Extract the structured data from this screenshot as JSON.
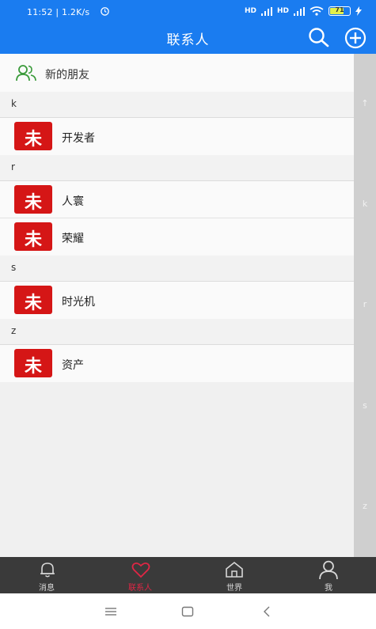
{
  "status": {
    "time": "11:52 | 1.2K/s",
    "battery": "71",
    "battery_pct": 71,
    "signal1": "HD",
    "signal2": "HD"
  },
  "header": {
    "title": "联系人",
    "search_icon": "search-icon",
    "add_icon": "plus-circle-icon",
    "bg": "#1a7cf0"
  },
  "new_friends": {
    "label": "新的朋友",
    "icon": "users-icon",
    "icon_color": "#3a9a3a"
  },
  "sections": [
    {
      "letter": "k",
      "contacts": [
        {
          "name": "开发者",
          "avatar": "未"
        }
      ]
    },
    {
      "letter": "r",
      "contacts": [
        {
          "name": "人寰",
          "avatar": "未"
        },
        {
          "name": "荣耀",
          "avatar": "未"
        }
      ]
    },
    {
      "letter": "s",
      "contacts": [
        {
          "name": "时光机",
          "avatar": "未"
        }
      ]
    },
    {
      "letter": "z",
      "contacts": [
        {
          "name": "资产",
          "avatar": "未"
        }
      ]
    }
  ],
  "index_bar": [
    "↑",
    "k",
    "r",
    "s",
    "z"
  ],
  "tabs": [
    {
      "label": "消息",
      "icon": "bell-icon",
      "active": false
    },
    {
      "label": "联系人",
      "icon": "heart-icon",
      "active": true
    },
    {
      "label": "世界",
      "icon": "home-icon",
      "active": false
    },
    {
      "label": "我",
      "icon": "user-icon",
      "active": false
    }
  ],
  "colors": {
    "avatar_red": "#d51616",
    "tab_active": "#e02645",
    "tab_bg": "#3a3a3a"
  }
}
